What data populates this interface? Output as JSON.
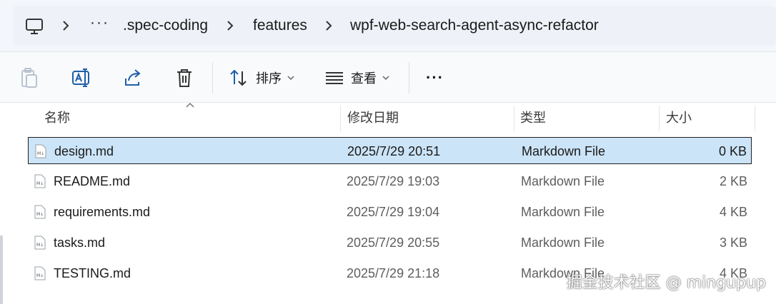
{
  "address": {
    "overflow": "···",
    "crumbs": [
      ".spec-coding",
      "features",
      "wpf-web-search-agent-async-refactor"
    ]
  },
  "toolbar": {
    "sort_label": "排序",
    "view_label": "查看",
    "more_label": "···"
  },
  "columns": {
    "name": "名称",
    "date": "修改日期",
    "type": "类型",
    "size": "大小"
  },
  "files": [
    {
      "name": "design.md",
      "date": "2025/7/29 20:51",
      "type": "Markdown File",
      "size": "0 KB",
      "selected": true
    },
    {
      "name": "README.md",
      "date": "2025/7/29 19:03",
      "type": "Markdown File",
      "size": "2 KB",
      "selected": false
    },
    {
      "name": "requirements.md",
      "date": "2025/7/29 19:04",
      "type": "Markdown File",
      "size": "4 KB",
      "selected": false
    },
    {
      "name": "tasks.md",
      "date": "2025/7/29 20:55",
      "type": "Markdown File",
      "size": "3 KB",
      "selected": false
    },
    {
      "name": "TESTING.md",
      "date": "2025/7/29 21:18",
      "type": "Markdown File",
      "size": "4 KB",
      "selected": false
    }
  ],
  "watermark": "掘金技术社区 @ mingupup",
  "colors": {
    "selection": "#cce4f7",
    "toolbar_icon": "#1f5fa8"
  }
}
